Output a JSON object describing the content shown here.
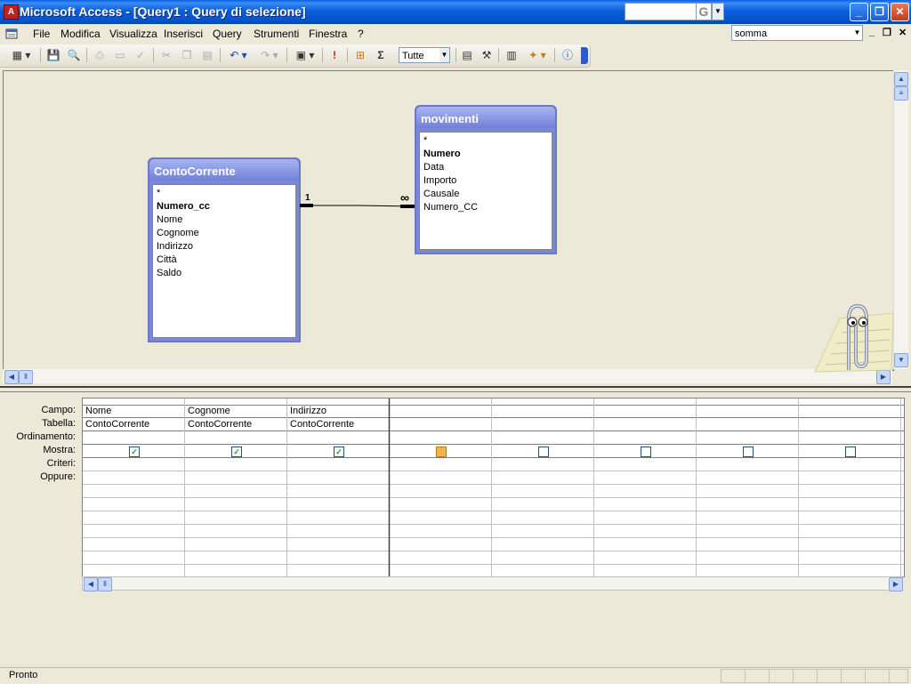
{
  "window": {
    "title": "Microsoft Access - [Query1 : Query di selezione]",
    "app_icon_letter": "A",
    "help_search_letter": "G",
    "controls": {
      "minimize": "_",
      "restore": "❐",
      "close": "✕"
    }
  },
  "menu": {
    "items": [
      "File",
      "Modifica",
      "Visualizza",
      "Inserisci",
      "Query",
      "Strumenti",
      "Finestra",
      "?"
    ],
    "question_box_value": "somma",
    "mdi_controls": {
      "minimize": "_",
      "restore": "❐",
      "close": "✕"
    }
  },
  "toolbar": {
    "query_type_combo": "Tutte",
    "sigma_label": "Σ",
    "icons": [
      "view-icon",
      "save-icon",
      "search-icon",
      "print-icon",
      "print-preview-icon",
      "spelling-icon",
      "cut-icon",
      "copy-icon",
      "paste-icon",
      "undo-icon",
      "redo-icon",
      "query-type-icon",
      "run-icon",
      "show-table-icon",
      "totals-icon",
      "properties-icon",
      "build-icon",
      "database-window-icon",
      "new-object-icon",
      "help-icon"
    ]
  },
  "tables": [
    {
      "name": "ContoCorrente",
      "fields": [
        {
          "name": "*",
          "key": false
        },
        {
          "name": "Numero_cc",
          "key": true
        },
        {
          "name": "Nome",
          "key": false
        },
        {
          "name": "Cognome",
          "key": false
        },
        {
          "name": "Indirizzo",
          "key": false
        },
        {
          "name": "Città",
          "key": false
        },
        {
          "name": "Saldo",
          "key": false
        }
      ]
    },
    {
      "name": "movimenti",
      "fields": [
        {
          "name": "*",
          "key": false
        },
        {
          "name": "Numero",
          "key": true
        },
        {
          "name": "Data",
          "key": false
        },
        {
          "name": "Importo",
          "key": false
        },
        {
          "name": "Causale",
          "key": false
        },
        {
          "name": "Numero_CC",
          "key": false
        }
      ]
    }
  ],
  "relationship": {
    "one_label": "1",
    "many_label": "∞"
  },
  "grid": {
    "row_labels": [
      "Campo:",
      "Tabella:",
      "Ordinamento:",
      "Mostra:",
      "Criteri:",
      "Oppure:"
    ],
    "columns": [
      {
        "campo": "Nome",
        "tabella": "ContoCorrente",
        "mostra": true
      },
      {
        "campo": "Cognome",
        "tabella": "ContoCorrente",
        "mostra": true
      },
      {
        "campo": "Indirizzo",
        "tabella": "ContoCorrente",
        "mostra": true
      },
      {
        "campo": "",
        "tabella": "",
        "mostra": false,
        "focused": true
      },
      {
        "campo": "",
        "tabella": "",
        "mostra": false
      },
      {
        "campo": "",
        "tabella": "",
        "mostra": false
      },
      {
        "campo": "",
        "tabella": "",
        "mostra": false
      },
      {
        "campo": "",
        "tabella": "",
        "mostra": false
      }
    ]
  },
  "status": {
    "text": "Pronto"
  },
  "colors": {
    "titlebar": "#0553d0",
    "table_caption": "#7a88d8",
    "checkbox_check": "#21a121",
    "focus_checkbox": "#f3b44a"
  }
}
